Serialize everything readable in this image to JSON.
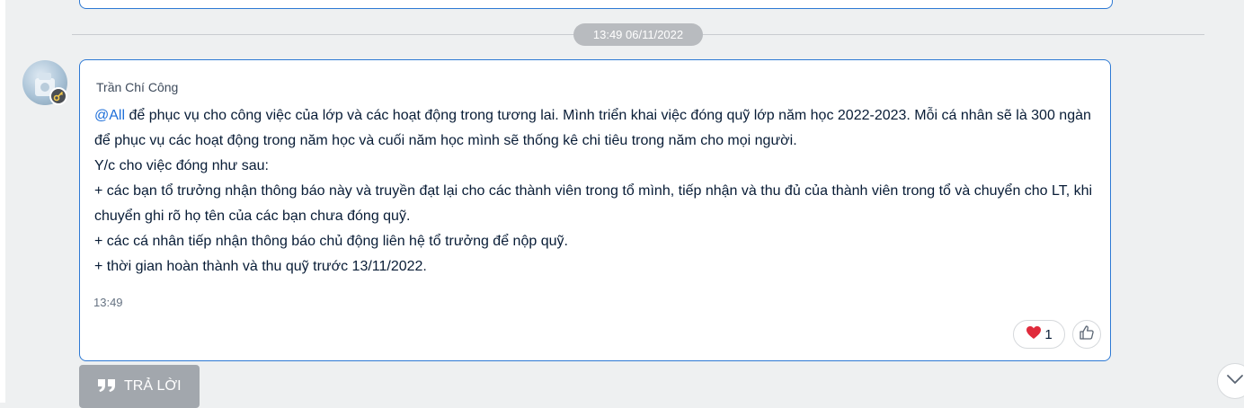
{
  "divider": {
    "date": "13:49 06/11/2022"
  },
  "message": {
    "sender": "Trần Chí Công",
    "mention": "@All",
    "body": " để phục vụ cho công việc của lớp và các hoạt động trong tương lai. Mình triển khai việc đóng quỹ lớp năm học 2022-2023. Mỗi cá nhân sẽ là 300 ngàn để phục vụ các hoạt động trong năm học  và cuối năm học mình sẽ thống kê chi tiêu trong năm cho mọi người.\nY/c cho việc đóng như sau:\n + các bạn tổ trưởng nhận thông báo này và truyền đạt lại cho các thành viên trong tổ mình, tiếp nhận và thu đủ của thành viên trong tổ và chuyển cho LT, khi chuyển ghi rõ họ tên của các bạn chưa đóng quỹ.\n + các cá nhân tiếp nhận thông báo chủ động liên hệ tổ trưởng để nộp quỹ.\n +  thời gian hoàn thành và thu quỹ trước 13/11/2022.",
    "time": "13:49",
    "reaction": {
      "icon": "heart-icon",
      "emoji": "❤️",
      "count": "1"
    },
    "like_icon": "thumbs-up-icon"
  },
  "reply_button": {
    "label": "TRẢ LỜI",
    "icon": "quote-icon"
  },
  "colors": {
    "accent": "#2d79d4",
    "mention": "#1e6fd9",
    "heart": "#e02b3c"
  }
}
